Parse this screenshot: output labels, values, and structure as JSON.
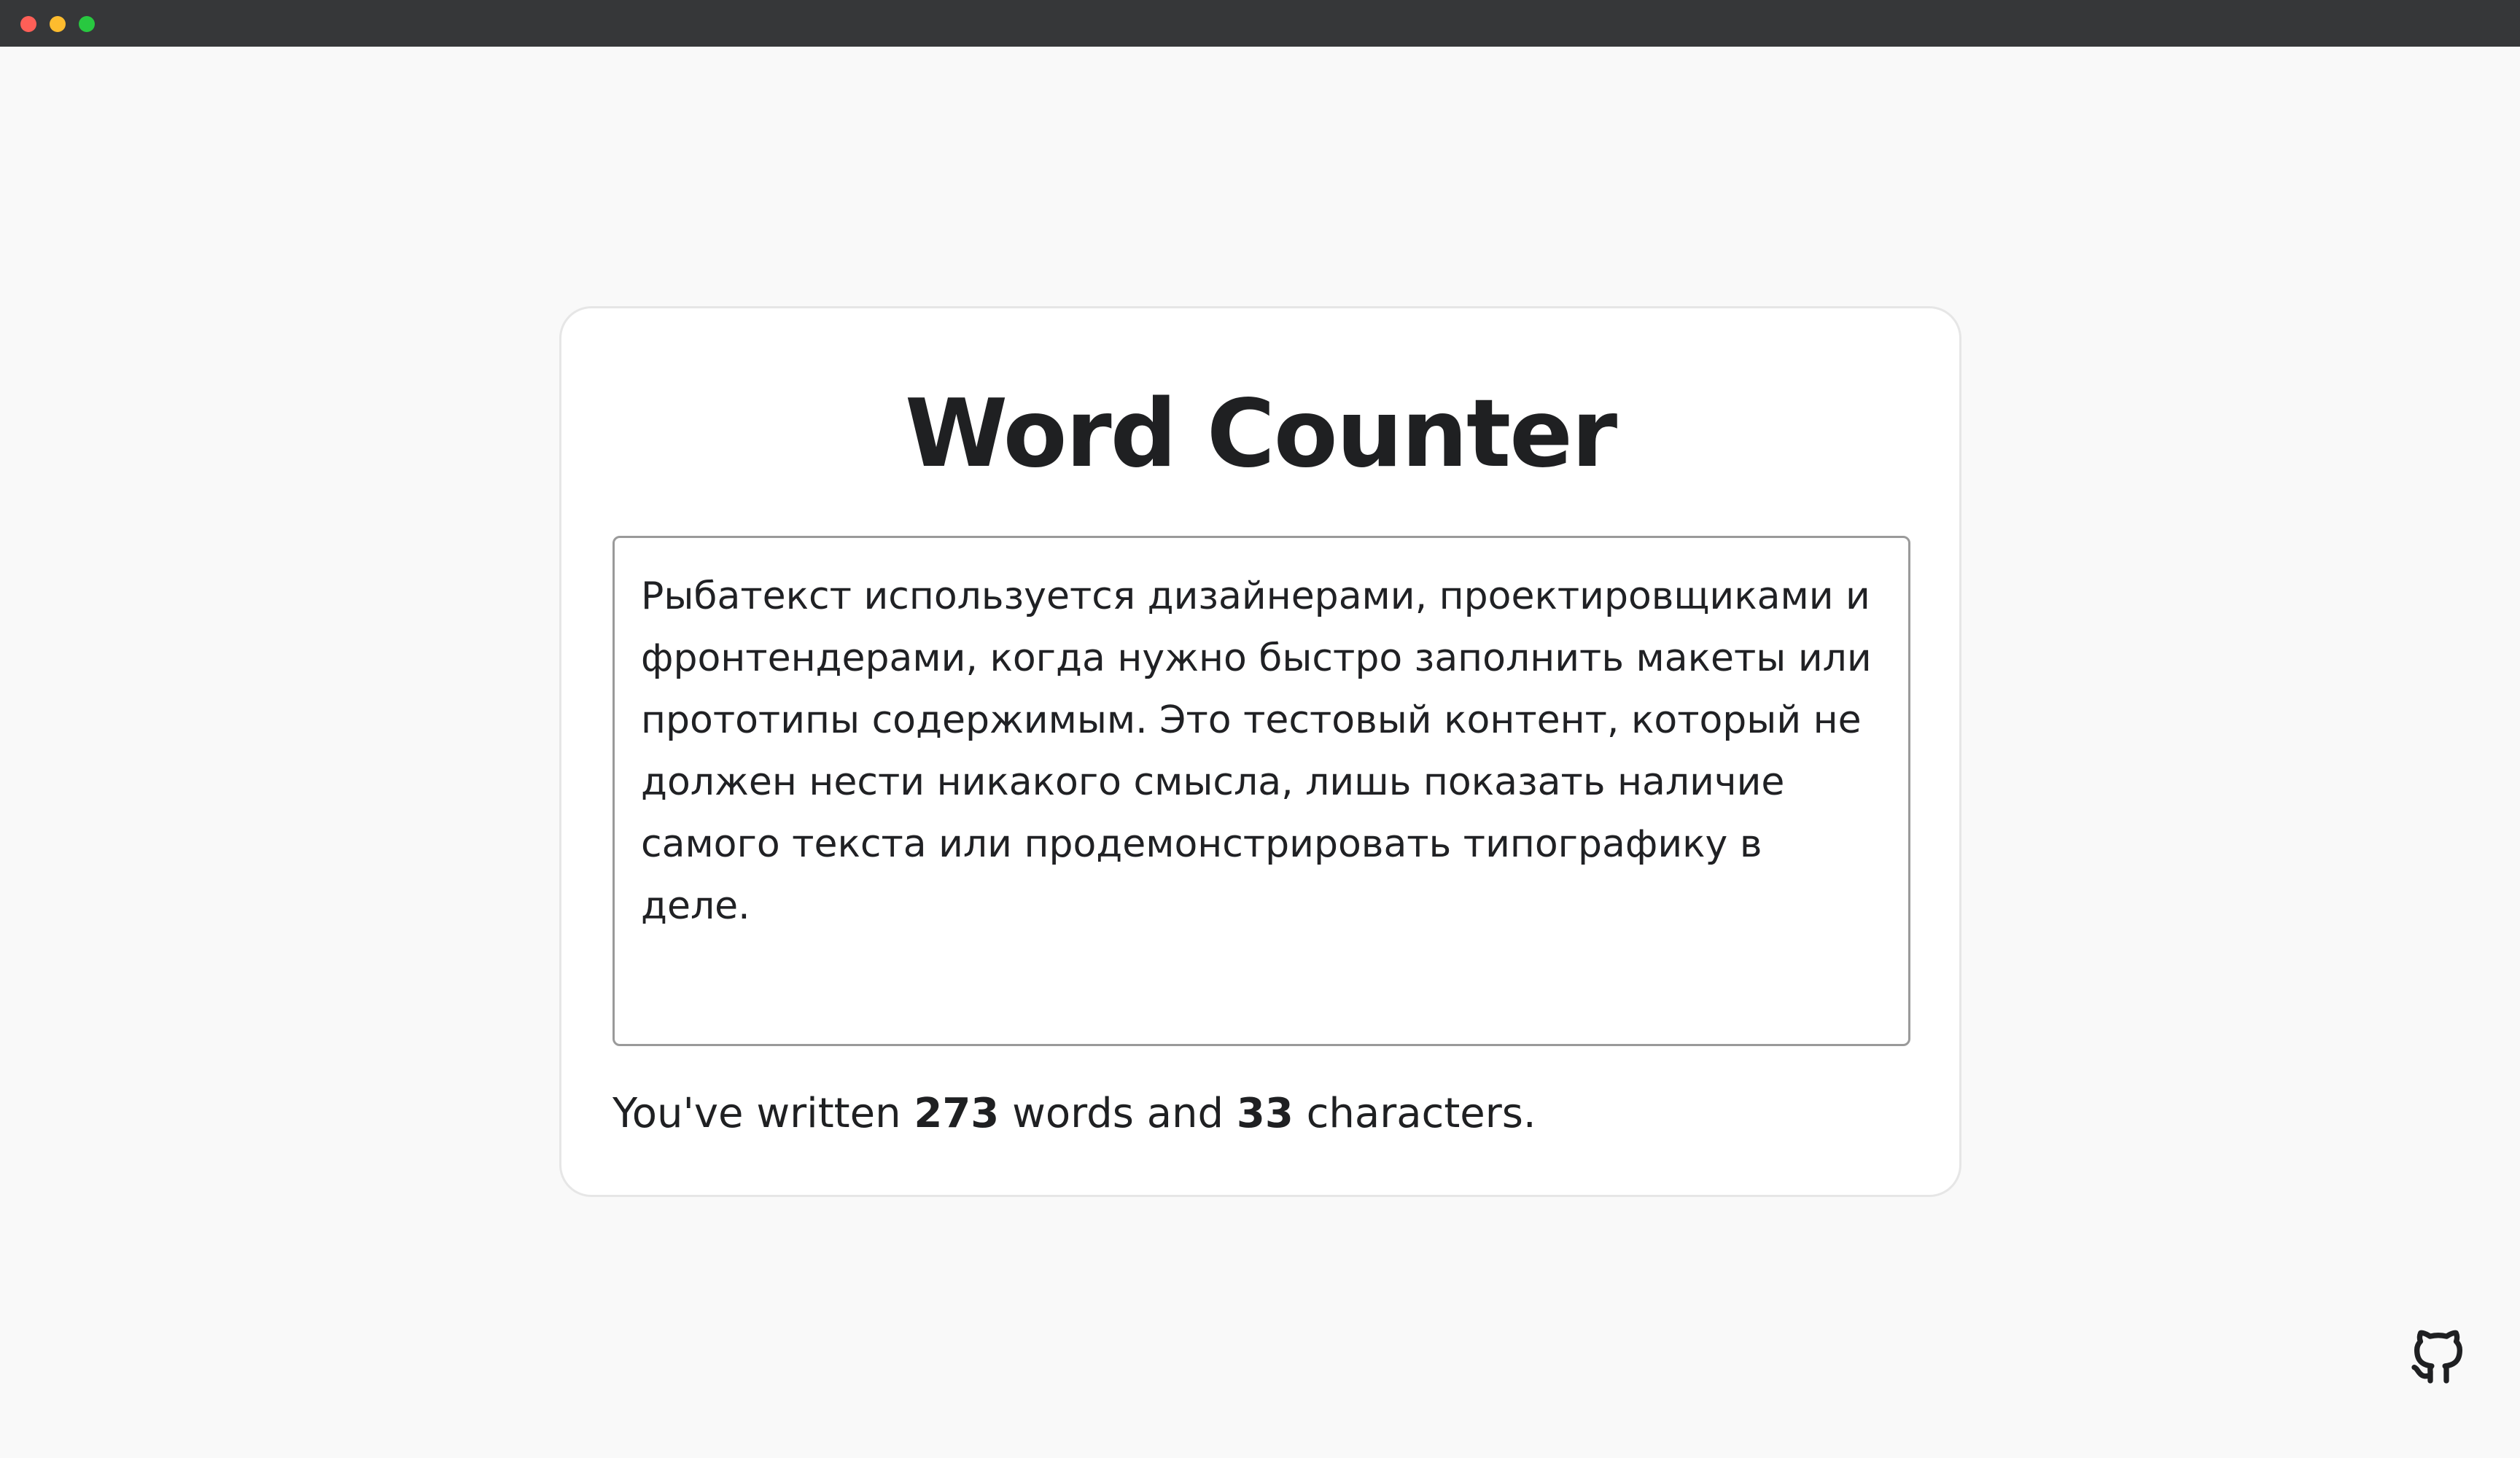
{
  "app": {
    "title": "Word Counter"
  },
  "editor": {
    "value": "Рыбатекст используется дизайнерами, проектировщиками и фронтендерами, когда нужно быстро заполнить макеты или прототипы содержимым. Это тестовый контент, который не должен нести никакого смысла, лишь показать наличие самого текста или продемонстрировать типографику в деле."
  },
  "stats": {
    "prefix": "You've written ",
    "words": "273",
    "middle": " words and ",
    "characters": "33",
    "suffix": " characters."
  },
  "colors": {
    "background": "#f9f9f9",
    "card": "#ffffff",
    "chrome": "#363739",
    "text": "#1f2022"
  },
  "icons": {
    "github": "github-icon"
  }
}
